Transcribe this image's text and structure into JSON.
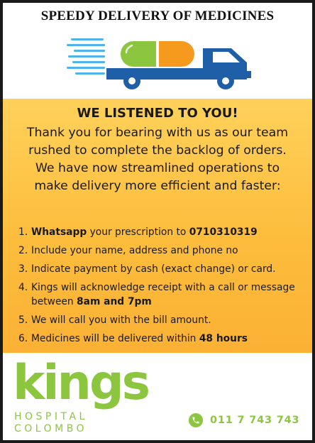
{
  "header": {
    "title": "SPEEDY DELIVERY OF MEDICINES"
  },
  "notice": {
    "headline": "WE LISTENED TO YOU!",
    "paragraph_lines": [
      "Thank you for bearing with us as our team",
      "rushed to complete the backlog of orders.",
      "We have now streamlined operations to",
      "make delivery more efficient and faster:"
    ]
  },
  "steps": [
    {
      "num": "1.",
      "bold1": "Whatsapp",
      "text1": " your prescription to ",
      "bold2": "0710310319"
    },
    {
      "num": "2.",
      "text1": "Include your name, address and phone no"
    },
    {
      "num": "3.",
      "text1": "Indicate payment by cash (exact change) or card."
    },
    {
      "num": "4.",
      "text1": "Kings will acknowledge receipt with a call or message between ",
      "bold1": "8am and 7pm"
    },
    {
      "num": "5.",
      "text1": "We will call you with the bill amount."
    },
    {
      "num": "6.",
      "text1": "Medicines will be delivered within ",
      "bold1": "48 hours"
    }
  ],
  "brand": {
    "logo_word": "kings",
    "logo_line1": "HOSPITAL",
    "logo_line2": "COLOMBO",
    "phone": "011 7 743 743",
    "brand_green": "#8cc63f",
    "truck_blue": "#1f5fa8",
    "capsule_green": "#8cc63f",
    "capsule_orange": "#f59a1c",
    "panel_yellow": "#fdbd3c"
  }
}
